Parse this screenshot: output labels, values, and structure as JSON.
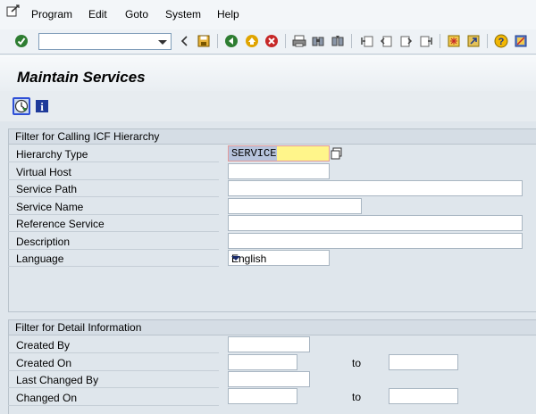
{
  "menu": {
    "items": [
      "Program",
      "Edit",
      "Goto",
      "System",
      "Help"
    ]
  },
  "toolbar": {
    "command_value": "",
    "icons": [
      "enter-icon",
      "back-arrow-icon",
      "save-icon",
      "back-icon",
      "exit-icon",
      "cancel-icon",
      "print-icon",
      "find-icon",
      "find-next-icon",
      "first-page-icon",
      "previous-page-icon",
      "next-page-icon",
      "last-page-icon",
      "new-session-icon",
      "shortcut-icon",
      "help-icon",
      "customize-layout-icon"
    ]
  },
  "title": "Maintain Services",
  "app_toolbar": {
    "icons": [
      "execute-icon",
      "info-icon"
    ]
  },
  "filter_hierarchy": {
    "title": "Filter for Calling ICF Hierarchy",
    "fields": [
      {
        "label": "Hierarchy Type",
        "value": "SERVICE"
      },
      {
        "label": "Virtual Host",
        "value": ""
      },
      {
        "label": "Service Path",
        "value": ""
      },
      {
        "label": "Service Name",
        "value": ""
      },
      {
        "label": "Reference Service",
        "value": ""
      },
      {
        "label": "Description",
        "value": ""
      },
      {
        "label": "Language",
        "value": "English"
      }
    ]
  },
  "filter_detail": {
    "title": "Filter for Detail Information",
    "fields": [
      {
        "label": "Created By",
        "value": ""
      },
      {
        "label": "Created On",
        "value": "",
        "to_label": "to",
        "to_value": ""
      },
      {
        "label": "Last Changed By",
        "value": ""
      },
      {
        "label": "Changed On",
        "value": "",
        "to_label": "to",
        "to_value": ""
      }
    ]
  },
  "colors": {
    "background": "#dfe6ec",
    "active_field": "#fff58a",
    "title_text": "#000000"
  }
}
